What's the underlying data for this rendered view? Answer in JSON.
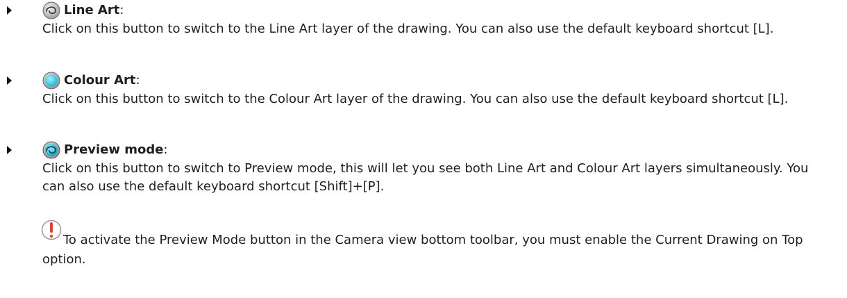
{
  "items": [
    {
      "icon": "line-art-icon",
      "title": "Line Art",
      "colon": ":",
      "description": "Click on this button to switch to the Line Art layer of the drawing. You can also use the default keyboard shortcut [L]."
    },
    {
      "icon": "colour-art-icon",
      "title": "Colour Art",
      "colon": ":",
      "description": "Click on this button to switch to the Colour Art layer of the drawing. You can also use the default keyboard shortcut [L]."
    },
    {
      "icon": "preview-mode-icon",
      "title": "Preview mode",
      "colon": ":",
      "description": "Click on this button to switch to Preview mode, this will let you see both Line Art and Colour Art layers simultaneously. You can also use the default keyboard shortcut [Shift]+[P]."
    }
  ],
  "note": {
    "icon": "warning-icon",
    "text": "To activate the Preview Mode button in the Camera view bottom toolbar, you must enable the Current Drawing on Top option."
  },
  "colors": {
    "text": "#1f1f1f",
    "accent_cyan": "#2ec8e0",
    "warning_red": "#d9443b"
  }
}
